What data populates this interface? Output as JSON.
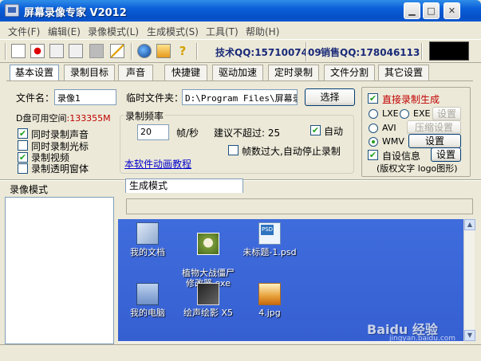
{
  "window": {
    "title": "屏幕录像专家 V2012"
  },
  "menu": [
    "文件(F)",
    "编辑(E)",
    "录像模式(L)",
    "生成模式(S)",
    "工具(T)",
    "帮助(H)"
  ],
  "toolbar": {
    "icons": [
      "new-icon",
      "record-icon",
      "pause-icon",
      "stop-icon",
      "camera-icon",
      "pen-icon",
      "globe-icon",
      "settings-icon",
      "help-icon"
    ],
    "tech_qq": "技术QQ:1571007409",
    "sales_qq": "销售QQ:178046113"
  },
  "tabs": [
    "基本设置",
    "录制目标",
    "声音",
    "快捷键",
    "驱动加速",
    "定时录制",
    "文件分割",
    "其它设置"
  ],
  "basic": {
    "filename_label": "文件名：",
    "filename_value": "录像1",
    "temp_folder_label": "临时文件夹：",
    "temp_folder_value": "D:\\Program Files\\屏幕录",
    "select_button": "选择",
    "disk_space_label": "D盘可用空间",
    "disk_space_value": ":133355M",
    "options": [
      {
        "label": "同时录制声音",
        "checked": true
      },
      {
        "label": "同时录制光标",
        "checked": false
      },
      {
        "label": "录制视频",
        "checked": true
      },
      {
        "label": "录制透明窗体",
        "checked": false
      }
    ],
    "frequency_group": "录制频率",
    "fps_value": "20",
    "fps_unit": "帧/秒",
    "fps_limit_text": "建议不超过: 25",
    "auto_label": "自动",
    "auto_checked": true,
    "auto_stop_label": "帧数过大,自动停止录制",
    "auto_stop_checked": false,
    "tutorial_link": "本软件动画教程"
  },
  "output": {
    "direct_label": "直接录制生成",
    "direct_checked": true,
    "lxe_label": "LXE",
    "exe_label": "EXE",
    "settings_disabled_label": "设置",
    "avi_label": "AVI",
    "compress_settings_label": "压缩设置",
    "wmv_label": "WMV",
    "wmv_settings_label": "设置",
    "custom_info_label": "自设信息",
    "custom_info_checked": true,
    "custom_settings_label": "设置",
    "custom_info_note": "(版权文字 logo图形)"
  },
  "lower": {
    "record_mode_label": "录像模式",
    "generate_mode_tab": "生成模式"
  },
  "desktop_icons": [
    {
      "label": "我的文档",
      "icon": "my-documents-icon"
    },
    {
      "label": "植物大战僵尸\n修改器.exe",
      "icon": "exe-icon"
    },
    {
      "label": "未标题-1.psd",
      "icon": "psd-file-icon"
    },
    {
      "label": "我的电脑",
      "icon": "my-computer-icon"
    },
    {
      "label": "绘声绘影 X5",
      "icon": "video-editor-icon"
    },
    {
      "label": "4.jpg",
      "icon": "jpg-file-icon"
    }
  ],
  "watermark": {
    "main": "Baidu 经验",
    "sub": "jingyan.baidu.com"
  }
}
